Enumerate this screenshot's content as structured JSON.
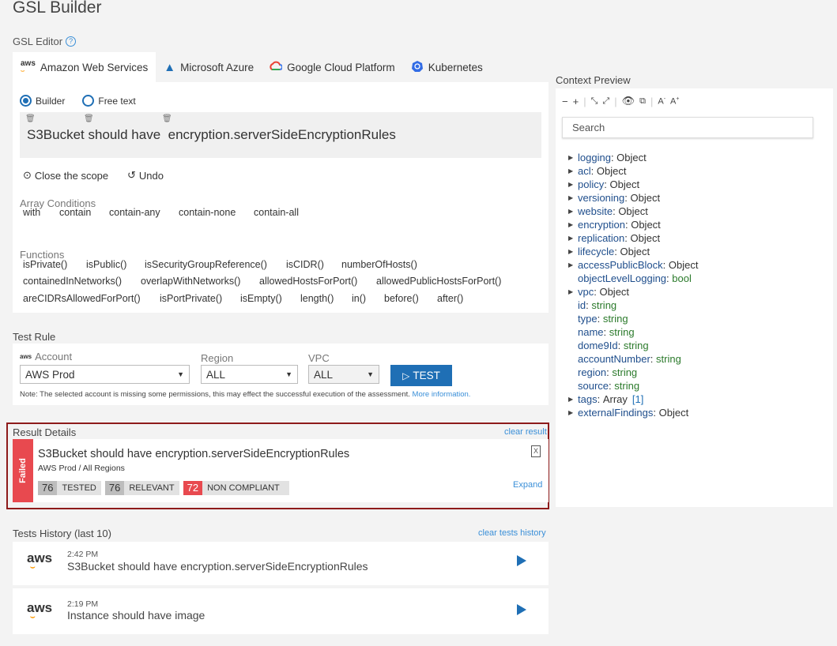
{
  "page_title": "GSL Builder",
  "editor_label": "GSL Editor",
  "tabs": [
    {
      "label": "Amazon Web Services",
      "icon": "aws-icon"
    },
    {
      "label": "Microsoft Azure",
      "icon": "azure-icon"
    },
    {
      "label": "Google Cloud Platform",
      "icon": "gcp-icon"
    },
    {
      "label": "Kubernetes",
      "icon": "kubernetes-icon"
    }
  ],
  "mode": {
    "builder": "Builder",
    "free_text": "Free text",
    "selected": "Builder"
  },
  "rule": {
    "part1": "S3Bucket should have",
    "part2": "encryption.serverSideEncryptionRules"
  },
  "actions": {
    "close_scope": "Close the scope",
    "undo": "Undo"
  },
  "array_conditions": {
    "title": "Array Conditions",
    "items": [
      "with",
      "contain",
      "contain-any",
      "contain-none",
      "contain-all"
    ]
  },
  "functions": {
    "title": "Functions",
    "row1": [
      "isPrivate()",
      "isPublic()",
      "isSecurityGroupReference()",
      "isCIDR()",
      "numberOfHosts()"
    ],
    "row2": [
      "containedInNetworks()",
      "overlapWithNetworks()",
      "allowedHostsForPort()",
      "allowedPublicHostsForPort()"
    ],
    "row3": [
      "areCIDRsAllowedForPort()",
      "isPortPrivate()",
      "isEmpty()",
      "length()",
      "in()",
      "before()",
      "after()"
    ]
  },
  "test_rule": {
    "title": "Test Rule",
    "account_label": "Account",
    "account_value": "AWS Prod",
    "region_label": "Region",
    "region_value": "ALL",
    "vpc_label": "VPC",
    "vpc_value": "ALL",
    "test_button": "TEST",
    "note": "Note: The selected account is missing some permissions, this may effect the successful execution of the assessment.",
    "note_link": "More information."
  },
  "result": {
    "title": "Result Details",
    "clear": "clear result",
    "status": "Failed",
    "rule": "S3Bucket should have encryption.serverSideEncryptionRules",
    "scope": "AWS Prod / All Regions",
    "tested_num": "76",
    "tested_label": "TESTED",
    "relevant_num": "76",
    "relevant_label": "RELEVANT",
    "noncompliant_num": "72",
    "noncompliant_label": "NON COMPLIANT",
    "expand": "Expand"
  },
  "history": {
    "title": "Tests History (last 10)",
    "clear": "clear tests history",
    "items": [
      {
        "time": "2:42 PM",
        "rule": "S3Bucket should have encryption.serverSideEncryptionRules"
      },
      {
        "time": "2:19 PM",
        "rule": "Instance should have image"
      }
    ]
  },
  "context": {
    "title": "Context Preview",
    "search_placeholder": "Search",
    "tree": [
      {
        "key": "logging",
        "type": "Object",
        "expandable": true
      },
      {
        "key": "acl",
        "type": "Object",
        "expandable": true
      },
      {
        "key": "policy",
        "type": "Object",
        "expandable": true
      },
      {
        "key": "versioning",
        "type": "Object",
        "expandable": true
      },
      {
        "key": "website",
        "type": "Object",
        "expandable": true
      },
      {
        "key": "encryption",
        "type": "Object",
        "expandable": true
      },
      {
        "key": "replication",
        "type": "Object",
        "expandable": true
      },
      {
        "key": "lifecycle",
        "type": "Object",
        "expandable": true
      },
      {
        "key": "accessPublicBlock",
        "type": "Object",
        "expandable": true
      },
      {
        "key": "objectLevelLogging",
        "type": "bool",
        "expandable": false
      },
      {
        "key": "vpc",
        "type": "Object",
        "expandable": true
      },
      {
        "key": "id",
        "type": "string",
        "expandable": false
      },
      {
        "key": "type",
        "type": "string",
        "expandable": false
      },
      {
        "key": "name",
        "type": "string",
        "expandable": false
      },
      {
        "key": "dome9Id",
        "type": "string",
        "expandable": false
      },
      {
        "key": "accountNumber",
        "type": "string",
        "expandable": false
      },
      {
        "key": "region",
        "type": "string",
        "expandable": false
      },
      {
        "key": "source",
        "type": "string",
        "expandable": false
      },
      {
        "key": "tags",
        "type": "Array",
        "count": "[1]",
        "expandable": true
      },
      {
        "key": "externalFindings",
        "type": "Object",
        "expandable": true
      }
    ]
  },
  "colors": {
    "accent": "#1f6fb5",
    "failed": "#e8494f",
    "highlight_border": "#8e1b1b"
  }
}
